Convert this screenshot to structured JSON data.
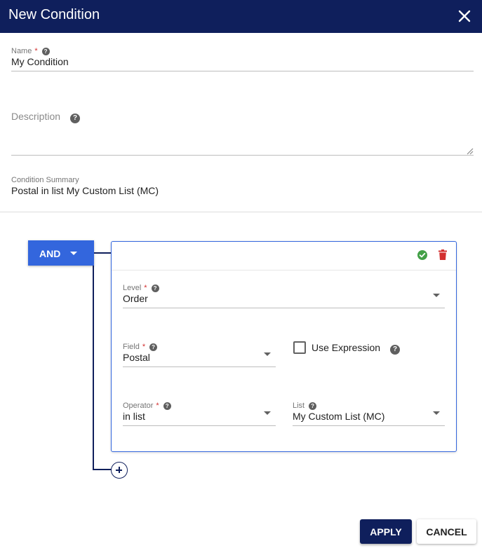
{
  "dialog": {
    "title": "New Condition",
    "close_icon": "close-icon",
    "header_color": "#0f1f5c"
  },
  "name": {
    "label": "Name",
    "required_mark": "*",
    "help_glyph": "?",
    "value": "My Condition"
  },
  "description": {
    "label": "Description",
    "help_glyph": "?",
    "value": ""
  },
  "summary": {
    "label": "Condition Summary",
    "value": "Postal in list My Custom List (MC)"
  },
  "group": {
    "operator_label": "AND",
    "accent_color": "#3366dd"
  },
  "condition": {
    "level": {
      "label": "Level",
      "required_mark": "*",
      "help_glyph": "?",
      "value": "Order"
    },
    "field": {
      "label": "Field",
      "required_mark": "*",
      "help_glyph": "?",
      "value": "Postal"
    },
    "use_expression": {
      "label": "Use Expression",
      "help_glyph": "?",
      "checked": false
    },
    "operator": {
      "label": "Operator",
      "required_mark": "*",
      "help_glyph": "?",
      "value": "in list"
    },
    "list": {
      "label": "List",
      "help_glyph": "?",
      "value": "My Custom List (MC)"
    },
    "valid_icon": "check-circle-icon",
    "delete_icon": "trash-icon",
    "valid_color": "#43a047",
    "delete_color": "#d32f2f"
  },
  "add_condition_icon": "plus-circle-icon",
  "footer": {
    "apply_label": "APPLY",
    "cancel_label": "CANCEL"
  }
}
